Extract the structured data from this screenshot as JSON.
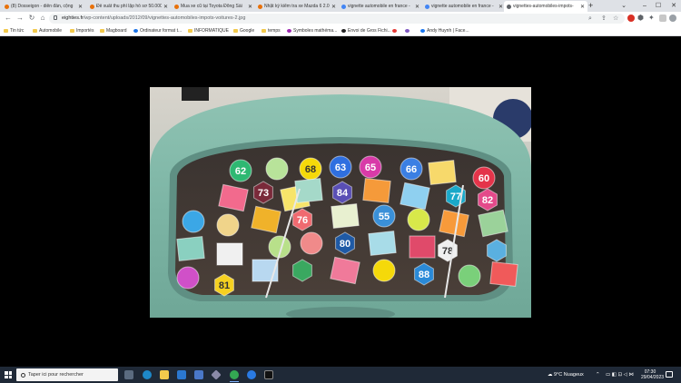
{
  "tabs": [
    {
      "label": "(8) Dosseigon - diễn đàn, cộng",
      "color": "#e8710a"
    },
    {
      "label": "Đề xuất thu phí lập hồ sơ 50.000",
      "color": "#e8710a"
    },
    {
      "label": "Mua xe cũ tại Toyota Đông Sài",
      "color": "#e8710a"
    },
    {
      "label": "Nhật ký kiểm tra xe Mazda 6 2.0",
      "color": "#e8710a"
    },
    {
      "label": "vignette automobile en france -",
      "color": "#4285f4"
    },
    {
      "label": "vignette automobile en france -",
      "color": "#4285f4"
    },
    {
      "label": "vignettes-automobiles-impots-",
      "color": "#5f6368"
    }
  ],
  "address": {
    "host": "eighties.fr",
    "path": "/wp-content/uploads/2012/09/vignettes-automobiles-impots-voitures-2.jpg"
  },
  "bookmarks": [
    {
      "label": "Tin tức",
      "kind": "folder"
    },
    {
      "label": "Automobile",
      "kind": "folder"
    },
    {
      "label": "Importés",
      "kind": "folder"
    },
    {
      "label": "Magboard",
      "kind": "folder"
    },
    {
      "label": "Ordinateur format t...",
      "kind": "round",
      "color": "#1a73e8"
    },
    {
      "label": "INFORMATIQUE",
      "kind": "folder"
    },
    {
      "label": "Google",
      "kind": "folder"
    },
    {
      "label": "temps",
      "kind": "folder"
    },
    {
      "label": "Symboles mathéma...",
      "kind": "round",
      "color": "#9c27b0"
    },
    {
      "label": "Envoi de Gros Fichi...",
      "kind": "round",
      "color": "#222"
    },
    {
      "label": "",
      "kind": "round",
      "color": "#e53935"
    },
    {
      "label": "",
      "kind": "round",
      "color": "#7e57c2"
    },
    {
      "label": "Andy Huynh | Face...",
      "kind": "round",
      "color": "#1877f2"
    }
  ],
  "taskbar": {
    "search_placeholder": "Taper ici pour rechercher",
    "weather": "9°C  Nuageux",
    "time": "07:30",
    "date": "29/04/2023"
  },
  "stickers": [
    {
      "t": "62",
      "c": "#2eb872",
      "s": "circle"
    },
    {
      "t": "",
      "c": "#b8e39a",
      "s": "circle"
    },
    {
      "t": "68",
      "c": "#f5d90a",
      "s": "circle"
    },
    {
      "t": "63",
      "c": "#2f6fe0",
      "s": "circle"
    },
    {
      "t": "65",
      "c": "#d83aa8",
      "s": "circle"
    },
    {
      "t": "66",
      "c": "#3b7fe3",
      "s": "circle"
    },
    {
      "t": "",
      "c": "#f7d96b",
      "s": "square"
    },
    {
      "t": "60",
      "c": "#e4344a",
      "s": "circle"
    },
    {
      "t": "73",
      "c": "#7a2a3a",
      "s": "hex"
    },
    {
      "t": "",
      "c": "#f26a8d",
      "s": "square"
    },
    {
      "t": "",
      "c": "#f7e46a",
      "s": "square"
    },
    {
      "t": "",
      "c": "#a5d9c9",
      "s": "square"
    },
    {
      "t": "84",
      "c": "#5a4fb5",
      "s": "hex"
    },
    {
      "t": "",
      "c": "#f59a3a",
      "s": "square"
    },
    {
      "t": "",
      "c": "#8fd0f0",
      "s": "square"
    },
    {
      "t": "77",
      "c": "#1aa9c9",
      "s": "hex"
    },
    {
      "t": "82",
      "c": "#e44a8a",
      "s": "hex"
    },
    {
      "t": "",
      "c": "#3ba7e6",
      "s": "circle"
    },
    {
      "t": "",
      "c": "#f0d48a",
      "s": "circle"
    },
    {
      "t": "",
      "c": "#f0b22a",
      "s": "square"
    },
    {
      "t": "76",
      "c": "#f06a70",
      "s": "hex"
    },
    {
      "t": "",
      "c": "#e8f0d0",
      "s": "square"
    },
    {
      "t": "55",
      "c": "#3a90d8",
      "s": "circle"
    },
    {
      "t": "",
      "c": "#d8e84a",
      "s": "circle"
    },
    {
      "t": "",
      "c": "#f79a3a",
      "s": "square"
    },
    {
      "t": "",
      "c": "#9bd29a",
      "s": "square"
    },
    {
      "t": "",
      "c": "#8ad0c0",
      "s": "square"
    },
    {
      "t": "",
      "c": "#f0f0f0",
      "s": "square"
    },
    {
      "t": "",
      "c": "#b8e08a",
      "s": "circle"
    },
    {
      "t": "",
      "c": "#f08a8a",
      "s": "circle"
    },
    {
      "t": "80",
      "c": "#1f5aa6",
      "s": "hex"
    },
    {
      "t": "",
      "c": "#a8dce8",
      "s": "square"
    },
    {
      "t": "",
      "c": "#e04a6a",
      "s": "square"
    },
    {
      "t": "78",
      "c": "#f0f0f0",
      "s": "hex"
    },
    {
      "t": "",
      "c": "#5ab0e0",
      "s": "hex"
    },
    {
      "t": "",
      "c": "#d050c8",
      "s": "circle"
    },
    {
      "t": "81",
      "c": "#f5d020",
      "s": "hex"
    },
    {
      "t": "",
      "c": "#b8d8f0",
      "s": "square"
    },
    {
      "t": "",
      "c": "#3aa860",
      "s": "hex"
    },
    {
      "t": "",
      "c": "#f07a9a",
      "s": "square"
    },
    {
      "t": "",
      "c": "#f5d90a",
      "s": "circle"
    },
    {
      "t": "88",
      "c": "#2a8ad8",
      "s": "hex"
    },
    {
      "t": "",
      "c": "#7ad07a",
      "s": "circle"
    },
    {
      "t": "",
      "c": "#f05a5a",
      "s": "square"
    }
  ]
}
